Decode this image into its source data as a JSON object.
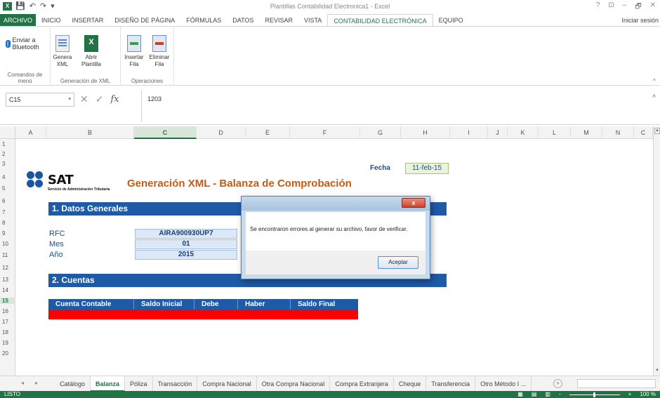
{
  "window": {
    "title": "Plantillas Contabilidad Electronica1 - Excel",
    "controls": [
      "?",
      "⊡",
      "–",
      "🗗",
      "✕"
    ],
    "app_icon": "X≣",
    "qat": [
      "💾",
      "↶",
      "↷",
      "▾"
    ]
  },
  "ribbon_tabs": [
    "ARCHIVO",
    "INICIO",
    "INSERTAR",
    "DISEÑO DE PÁGINA",
    "FÓRMULAS",
    "DATOS",
    "REVISAR",
    "VISTA",
    "CONTABILIDAD ELECTRÓNICA",
    "EQUIPO"
  ],
  "active_tab_index": 8,
  "signin": "Iniciar sesión",
  "ribbon": {
    "bluetooth": "Enviar a Bluetooth",
    "bluetooth_icon": "bluetooth-icon",
    "groups": {
      "menu": "Comandos de menú",
      "xml": "Generación de XML",
      "ops": "Operaciones"
    },
    "buttons": {
      "genera": [
        "Genera",
        "XML"
      ],
      "abrir": [
        "Abrir",
        "Plantilla"
      ],
      "insertar": [
        "Insertar",
        "Fila"
      ],
      "eliminar": [
        "Eliminar",
        "Fila"
      ]
    },
    "collapse": "^"
  },
  "formula_bar": {
    "name_box": "C15",
    "name_box_arrow": "▾",
    "cancel": "✕",
    "enter": "✓",
    "fx": "fx",
    "value": "1203",
    "collapse": "^"
  },
  "columns": [
    "A",
    "B",
    "C",
    "D",
    "E",
    "F",
    "G",
    "H",
    "I",
    "J",
    "K",
    "L",
    "M",
    "N",
    "C"
  ],
  "selected_column": "C",
  "rows": [
    "1",
    "2",
    "3",
    "4",
    "5",
    "6",
    "7",
    "8",
    "9",
    "10",
    "11",
    "12",
    "13",
    "14",
    "15",
    "16",
    "17",
    "18",
    "19",
    "20"
  ],
  "selected_row": "15",
  "sheet": {
    "sat_logo": "SAT",
    "sat_sub": "Servicio de Administración Tributaria",
    "fecha_label": "Fecha",
    "fecha_value": "11-feb-15",
    "main_title": "Generación XML - Balanza de Comprobación",
    "section1": "1. Datos Generales",
    "rfc_label": "RFC",
    "mes_label": "Mes",
    "anio_label": "Año",
    "rfc_value": "AIRA900930UP7",
    "mes_value": "01",
    "anio_value": "2015",
    "section2": "2. Cuentas",
    "cuentas_headers": [
      "Cuenta Contable",
      "Saldo Inicial",
      "Debe",
      "Haber",
      "Saldo Final"
    ]
  },
  "dialog": {
    "close": "x",
    "message": "Se encontraron errores al generar su archivo, favor de verificar.",
    "ok": "Aceptar"
  },
  "sheet_tabs": [
    "Catálogo",
    "Balanza",
    "Póliza",
    "Transacción",
    "Compra Nacional",
    "Otra Compra Nacional",
    "Compra Extranjera",
    "Cheque",
    "Transferencia",
    "Otro Método I ..."
  ],
  "active_sheet_index": 1,
  "sheet_nav": [
    "◂",
    "▸"
  ],
  "sheet_add": "+",
  "status": {
    "text": "LISTO",
    "zoom": "100 %",
    "zoom_minus": "-",
    "zoom_plus": "+",
    "view_icons": [
      "▦",
      "▤",
      "▥"
    ]
  },
  "colors": {
    "excel_green": "#217346",
    "header_blue": "#1f5aa6",
    "title_orange": "#c55a11",
    "error_red": "#ff0000"
  }
}
